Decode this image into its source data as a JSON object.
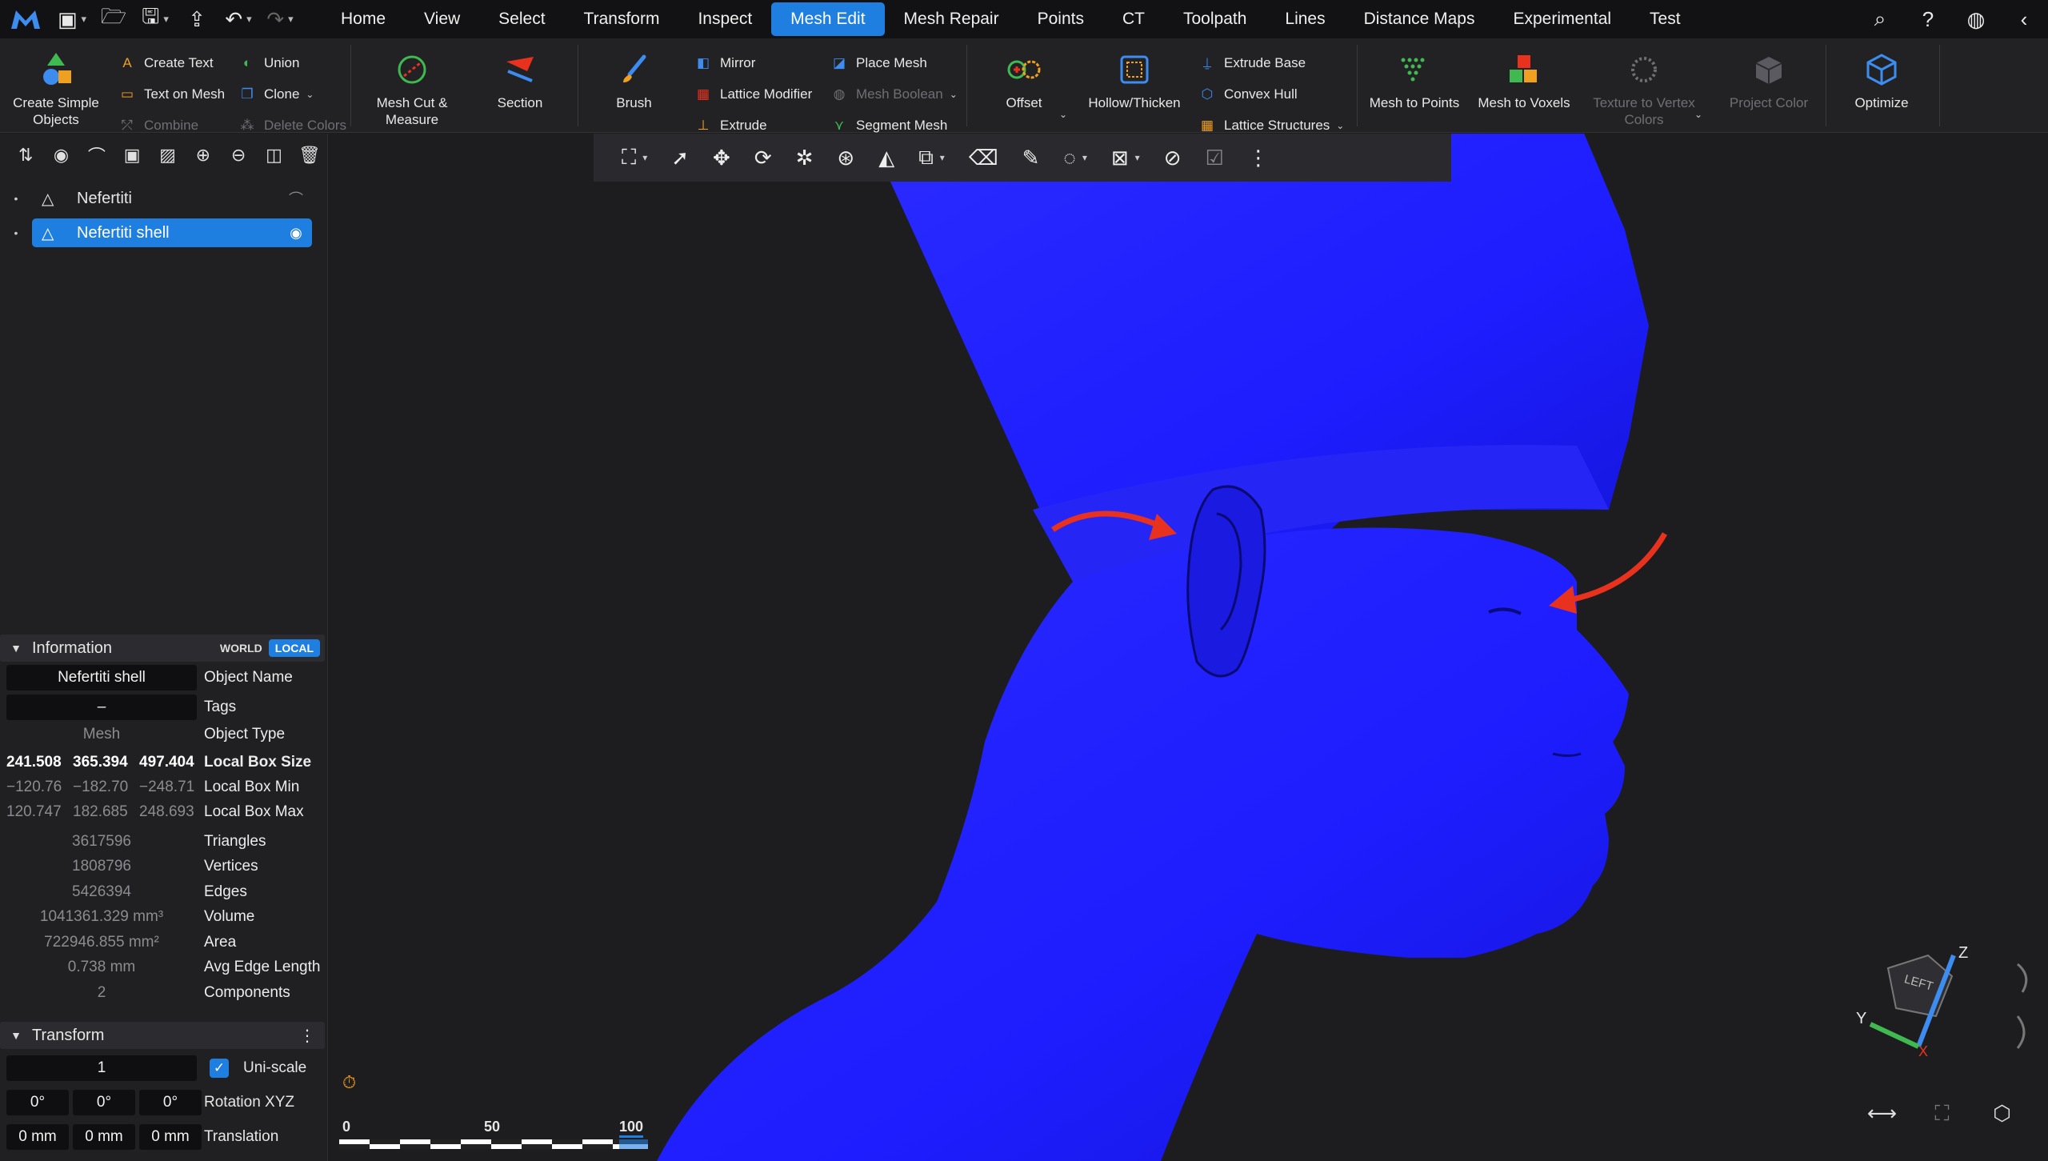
{
  "menubar": {
    "tabs": [
      "Home",
      "View",
      "Select",
      "Transform",
      "Inspect",
      "Mesh Edit",
      "Mesh Repair",
      "Points",
      "CT",
      "Toolpath",
      "Lines",
      "Distance Maps",
      "Experimental",
      "Test"
    ],
    "active_tab": "Mesh Edit"
  },
  "ribbon": {
    "create_simple_objects": "Create Simple Objects",
    "create_text": "Create Text",
    "text_on_mesh": "Text on Mesh",
    "combine": "Combine",
    "union": "Union",
    "clone": "Clone",
    "delete_colors": "Delete Colors",
    "mesh_cut_measure": "Mesh Cut & Measure",
    "section": "Section",
    "brush": "Brush",
    "mirror": "Mirror",
    "lattice_modifier": "Lattice Modifier",
    "extrude": "Extrude",
    "place_mesh": "Place Mesh",
    "mesh_boolean": "Mesh Boolean",
    "segment_mesh": "Segment Mesh",
    "offset": "Offset",
    "hollow_thicken": "Hollow/Thicken",
    "extrude_base": "Extrude Base",
    "convex_hull": "Convex Hull",
    "lattice_structures": "Lattice Structures",
    "mesh_to_points": "Mesh to Points",
    "mesh_to_voxels": "Mesh to Voxels",
    "texture_to_vertex_colors": "Texture to Vertex Colors",
    "project_color": "Project Color",
    "optimize": "Optimize"
  },
  "scene_tree": {
    "items": [
      {
        "name": "Nefertiti",
        "selected": false,
        "visible": false
      },
      {
        "name": "Nefertiti shell",
        "selected": true,
        "visible": true
      }
    ]
  },
  "information": {
    "title": "Information",
    "world": "WORLD",
    "local": "LOCAL",
    "object_name_value": "Nefertiti shell",
    "object_name_label": "Object Name",
    "tags_value": "–",
    "tags_label": "Tags",
    "object_type_value": "Mesh",
    "object_type_label": "Object Type",
    "box_size": [
      "241.508",
      "365.394",
      "497.404"
    ],
    "box_size_label": "Local Box Size",
    "box_min": [
      "−120.76",
      "−182.70",
      "−248.71"
    ],
    "box_min_label": "Local Box Min",
    "box_max": [
      "120.747",
      "182.685",
      "248.693"
    ],
    "box_max_label": "Local Box Max",
    "triangles": "3617596",
    "triangles_label": "Triangles",
    "vertices": "1808796",
    "vertices_label": "Vertices",
    "edges": "5426394",
    "edges_label": "Edges",
    "volume": "1041361.329 mm³",
    "volume_label": "Volume",
    "area": "722946.855 mm²",
    "area_label": "Area",
    "avg_edge": "0.738 mm",
    "avg_edge_label": "Avg Edge Length",
    "components": "2",
    "components_label": "Components"
  },
  "transform": {
    "title": "Transform",
    "scale": "1",
    "uniscale_label": "Uni-scale",
    "rotation": [
      "0°",
      "0°",
      "0°"
    ],
    "rotation_label": "Rotation XYZ",
    "translation": [
      "0 mm",
      "0 mm",
      "0 mm"
    ],
    "translation_label": "Translation"
  },
  "viewport": {
    "mesh_color": "#1d1dff",
    "arrow_color": "#e8321e",
    "scale_labels": [
      "0",
      "50",
      "100"
    ],
    "gizmo": {
      "cube_face": "LEFT",
      "axis_x": "X",
      "axis_y": "Y",
      "axis_z": "Z"
    }
  },
  "colors": {
    "accent": "#1f7fe0"
  }
}
